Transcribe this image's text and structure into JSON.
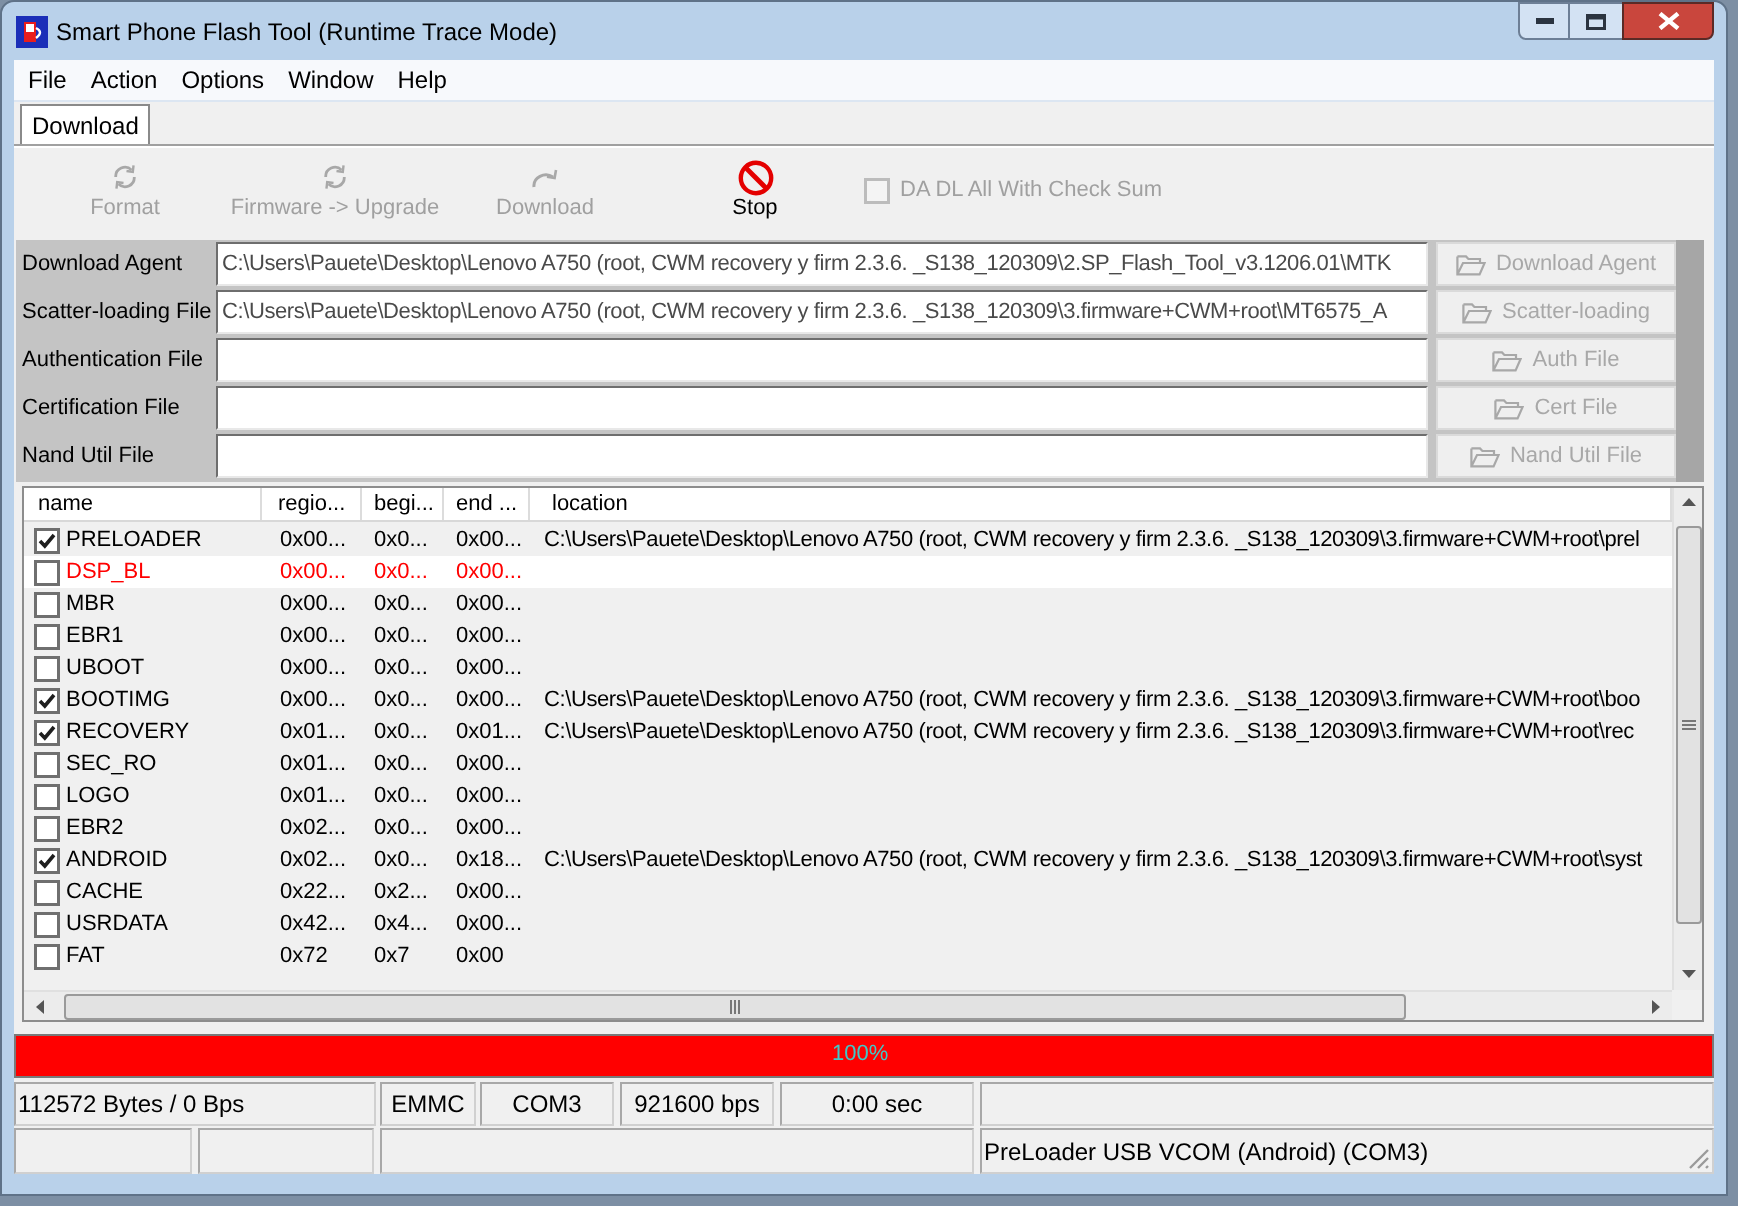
{
  "window": {
    "title": "Smart Phone Flash Tool (Runtime Trace Mode)"
  },
  "menu": [
    "File",
    "Action",
    "Options",
    "Window",
    "Help"
  ],
  "tabs": [
    {
      "label": "Download",
      "selected": true
    }
  ],
  "toolbar": {
    "buttons": [
      {
        "label": "Format",
        "kind": "cycle",
        "disabled": true
      },
      {
        "label": "Firmware -> Upgrade",
        "kind": "cycle",
        "disabled": true
      },
      {
        "label": "Download",
        "kind": "redo",
        "disabled": true
      },
      {
        "label": "Stop",
        "kind": "stop",
        "disabled": false
      }
    ],
    "checksum": {
      "label": "DA DL All With Check Sum",
      "checked": false,
      "disabled": true
    }
  },
  "files": [
    {
      "label": "Download Agent",
      "value": "C:\\Users\\Pauete\\Desktop\\Lenovo A750 (root, CWM recovery y firm 2.3.6. _S138_120309\\2.SP_Flash_Tool_v3.1206.01\\MTK",
      "button": {
        "label": "Download Agent",
        "disabled": true
      }
    },
    {
      "label": "Scatter-loading File",
      "value": "C:\\Users\\Pauete\\Desktop\\Lenovo A750 (root, CWM recovery y firm 2.3.6. _S138_120309\\3.firmware+CWM+root\\MT6575_A",
      "button": {
        "label": "Scatter-loading",
        "disabled": true
      }
    },
    {
      "label": "Authentication File",
      "button": {
        "label": "Auth File",
        "disabled": true
      }
    },
    {
      "label": "Certification File",
      "button": {
        "label": "Cert File",
        "disabled": true
      }
    },
    {
      "label": "Nand Util File",
      "button": {
        "label": "Nand Util File",
        "disabled": true
      }
    }
  ],
  "table": {
    "columns": [
      "name",
      "regio...",
      "begi...",
      "end ...",
      "location"
    ],
    "rows": [
      {
        "name": "PRELOADER",
        "checked": true,
        "selected": false,
        "invalid": false,
        "values": [
          "0x00...",
          "0x0...",
          "0x00..."
        ],
        "location": "C:\\Users\\Pauete\\Desktop\\Lenovo A750 (root, CWM recovery y firm 2.3.6. _S138_120309\\3.firmware+CWM+root\\prel"
      },
      {
        "name": "DSP_BL",
        "checked": false,
        "selected": true,
        "invalid": true,
        "values": [
          "0x00...",
          "0x0...",
          "0x00..."
        ]
      },
      {
        "name": "MBR",
        "checked": false,
        "selected": false,
        "invalid": false,
        "values": [
          "0x00...",
          "0x0...",
          "0x00..."
        ]
      },
      {
        "name": "EBR1",
        "checked": false,
        "selected": false,
        "invalid": false,
        "values": [
          "0x00...",
          "0x0...",
          "0x00..."
        ]
      },
      {
        "name": "UBOOT",
        "checked": false,
        "selected": false,
        "invalid": false,
        "values": [
          "0x00...",
          "0x0...",
          "0x00..."
        ]
      },
      {
        "name": "BOOTIMG",
        "checked": true,
        "selected": false,
        "invalid": false,
        "values": [
          "0x00...",
          "0x0...",
          "0x00..."
        ],
        "location": "C:\\Users\\Pauete\\Desktop\\Lenovo A750 (root, CWM recovery y firm 2.3.6. _S138_120309\\3.firmware+CWM+root\\boo"
      },
      {
        "name": "RECOVERY",
        "checked": true,
        "selected": false,
        "invalid": false,
        "values": [
          "0x01...",
          "0x0...",
          "0x01..."
        ],
        "location": "C:\\Users\\Pauete\\Desktop\\Lenovo A750 (root, CWM recovery y firm 2.3.6. _S138_120309\\3.firmware+CWM+root\\rec"
      },
      {
        "name": "SEC_RO",
        "checked": false,
        "selected": false,
        "invalid": false,
        "values": [
          "0x01...",
          "0x0...",
          "0x00..."
        ]
      },
      {
        "name": "LOGO",
        "checked": false,
        "selected": false,
        "invalid": false,
        "values": [
          "0x01...",
          "0x0...",
          "0x00..."
        ]
      },
      {
        "name": "EBR2",
        "checked": false,
        "selected": false,
        "invalid": false,
        "values": [
          "0x02...",
          "0x0...",
          "0x00..."
        ]
      },
      {
        "name": "ANDROID",
        "checked": true,
        "selected": false,
        "invalid": false,
        "values": [
          "0x02...",
          "0x0...",
          "0x18..."
        ],
        "location": "C:\\Users\\Pauete\\Desktop\\Lenovo A750 (root, CWM recovery y firm 2.3.6. _S138_120309\\3.firmware+CWM+root\\syst"
      },
      {
        "name": "CACHE",
        "checked": false,
        "selected": false,
        "invalid": false,
        "values": [
          "0x22...",
          "0x2...",
          "0x00..."
        ]
      },
      {
        "name": "USRDATA",
        "checked": false,
        "selected": false,
        "invalid": false,
        "values": [
          "0x42...",
          "0x4...",
          "0x00..."
        ]
      },
      {
        "name": "FAT",
        "checked": false,
        "selected": false,
        "invalid": false,
        "values": [
          "0x72",
          "0x7",
          "0x00"
        ]
      }
    ]
  },
  "progress": {
    "level": 1,
    "label": "100%"
  },
  "status_bar": {
    "row_1": [
      "112572 Bytes / 0 Bps",
      "EMMC",
      "COM3",
      "921600 bps",
      "0:00 sec"
    ],
    "row_2": [
      "PreLoader USB VCOM (Android) (COM3)"
    ]
  }
}
